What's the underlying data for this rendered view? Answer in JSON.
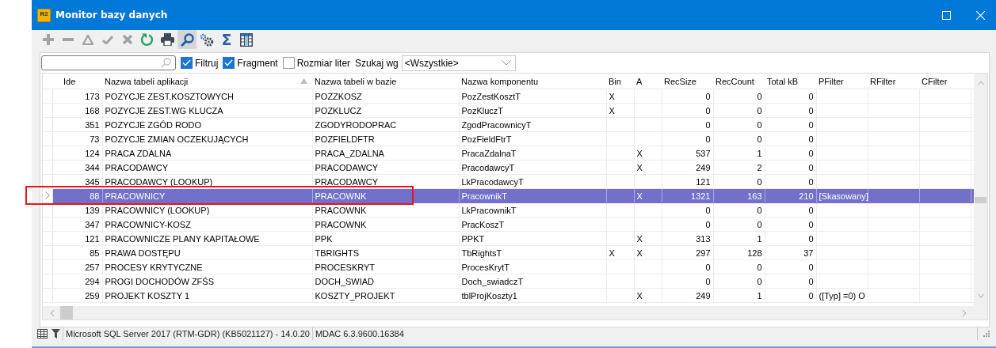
{
  "window": {
    "logo_text": "R2",
    "title": "Monitor bazy danych"
  },
  "toolbar": [
    {
      "kind": "add",
      "disabled": true,
      "pressed": false
    },
    {
      "kind": "remove",
      "disabled": true,
      "pressed": false
    },
    {
      "kind": "delta",
      "disabled": true,
      "pressed": false
    },
    {
      "kind": "confirm",
      "disabled": true,
      "pressed": false
    },
    {
      "kind": "cancel",
      "disabled": true,
      "pressed": false
    },
    {
      "kind": "refresh",
      "disabled": false,
      "pressed": false
    },
    {
      "kind": "print",
      "disabled": false,
      "pressed": false
    },
    {
      "kind": "search",
      "disabled": false,
      "pressed": true
    },
    {
      "kind": "settings",
      "disabled": false,
      "pressed": false
    },
    {
      "kind": "sum",
      "glyph": "Σ",
      "disabled": false,
      "pressed": false
    },
    {
      "kind": "columns",
      "disabled": false,
      "pressed": false
    }
  ],
  "filter_bar": {
    "checkboxes": [
      {
        "label": "Filtruj",
        "checked": true
      },
      {
        "label": "Fragment",
        "checked": true
      },
      {
        "label": "Rozmiar liter",
        "checked": false
      }
    ],
    "search_by_label": "Szukaj wg",
    "search_by_value": "<Wszystkie>"
  },
  "table": {
    "columns": [
      {
        "label": "Ide",
        "sorted": false
      },
      {
        "label": "Nazwa tabeli aplikacji",
        "sorted": true
      },
      {
        "label": "Nazwa tabeli w bazie",
        "sorted": false
      },
      {
        "label": "Nazwa komponentu",
        "sorted": false
      },
      {
        "label": "Bin",
        "sorted": false
      },
      {
        "label": "A",
        "sorted": false
      },
      {
        "label": "RecSize",
        "sorted": false
      },
      {
        "label": "RecCount",
        "sorted": false
      },
      {
        "label": "Total kB",
        "sorted": false
      },
      {
        "label": "PFilter",
        "sorted": false
      },
      {
        "label": "RFilter",
        "sorted": false
      },
      {
        "label": "CFilter",
        "sorted": false
      }
    ],
    "rows": [
      {
        "selected": false,
        "ide": "173",
        "app_name": "POZYCJE ZEST.KOSZTOWYCH",
        "db_name": "POZZKOSZ",
        "component": "PozZestKosztT",
        "bin": "X",
        "rec_size": "0",
        "rec_count": "0",
        "total_kb": "0"
      },
      {
        "selected": false,
        "ide": "168",
        "app_name": "POZYCJE ZEST.WG KLUCZA",
        "db_name": "POZKLUCZ",
        "component": "PozKluczT",
        "bin": "X",
        "rec_size": "0",
        "rec_count": "0",
        "total_kb": "0"
      },
      {
        "selected": false,
        "ide": "351",
        "app_name": "POZYCJE ZGÓD RODO",
        "db_name": "ZGODYRODOPRAC",
        "component": "ZgodPracownicyT",
        "rec_size": "0",
        "rec_count": "0",
        "total_kb": "0"
      },
      {
        "selected": false,
        "ide": "73",
        "app_name": "POZYCJE ZMIAN OCZEKUJĄCYCH",
        "db_name": "POZFIELDFTR",
        "component": "PozFieldFtrT",
        "rec_size": "0",
        "rec_count": "0",
        "total_kb": "0"
      },
      {
        "selected": false,
        "ide": "124",
        "app_name": "PRACA ZDALNA",
        "db_name": "PRACA_ZDALNA",
        "component": "PracaZdalnaT",
        "a": "X",
        "rec_size": "537",
        "rec_count": "1",
        "total_kb": "0"
      },
      {
        "selected": false,
        "ide": "344",
        "app_name": "PRACODAWCY",
        "db_name": "PRACODAWCY",
        "component": "PracodawcyT",
        "a": "X",
        "rec_size": "249",
        "rec_count": "2",
        "total_kb": "0"
      },
      {
        "selected": false,
        "ide": "345",
        "app_name": "PRACODAWCY (LOOKUP)",
        "db_name": "PRACODAWCY",
        "component": "LkPracodawcyT",
        "rec_size": "121",
        "rec_count": "0",
        "total_kb": "0"
      },
      {
        "selected": true,
        "ide": "88",
        "app_name": "PRACOWNICY",
        "db_name": "PRACOWNK",
        "component": "PracownikT",
        "a": "X",
        "rec_size": "1321",
        "rec_count": "163",
        "total_kb": "210",
        "pfilter": "[Skasowany]"
      },
      {
        "selected": false,
        "ide": "139",
        "app_name": "PRACOWNICY (LOOKUP)",
        "db_name": "PRACOWNK",
        "component": "LkPracownikT",
        "rec_size": "0",
        "rec_count": "0",
        "total_kb": "0"
      },
      {
        "selected": false,
        "ide": "347",
        "app_name": "PRACOWNICY-KOSZ",
        "db_name": "PRACOWNK",
        "component": "PracKoszT",
        "rec_size": "0",
        "rec_count": "0",
        "total_kb": "0"
      },
      {
        "selected": false,
        "ide": "121",
        "app_name": "PRACOWNICZE PLANY KAPITAŁOWE",
        "db_name": "PPK",
        "component": "PPKT",
        "a": "X",
        "rec_size": "313",
        "rec_count": "1",
        "total_kb": "0"
      },
      {
        "selected": false,
        "ide": "85",
        "app_name": "PRAWA DOSTĘPU",
        "db_name": "TBRIGHTS",
        "component": "TbRightsT",
        "bin": "X",
        "a": "X",
        "rec_size": "297",
        "rec_count": "128",
        "total_kb": "37"
      },
      {
        "selected": false,
        "ide": "257",
        "app_name": "PROCESY KRYTYCZNE",
        "db_name": "PROCESKRYT",
        "component": "ProcesKrytT",
        "rec_size": "0",
        "rec_count": "0",
        "total_kb": "0"
      },
      {
        "selected": false,
        "ide": "294",
        "app_name": "PROGI DOCHODÓW ZFŚS",
        "db_name": "DOCH_SWIAD",
        "component": "Doch_swiadczT",
        "rec_size": "0",
        "rec_count": "0",
        "total_kb": "0"
      },
      {
        "selected": false,
        "ide": "259",
        "app_name": "PROJEKT KOSZTY 1",
        "db_name": "KOSZTY_PROJEKT",
        "component": "tblProjKoszty1",
        "a": "X",
        "rec_size": "249",
        "rec_count": "1",
        "total_kb": "0",
        "pfilter": "([Typ] =0) O"
      }
    ]
  },
  "status_bar": {
    "server": "Microsoft SQL Server 2017 (RTM-GDR) (KB5021127) - 14.0.20",
    "mdac": "MDAC 6.3.9600.16384"
  }
}
